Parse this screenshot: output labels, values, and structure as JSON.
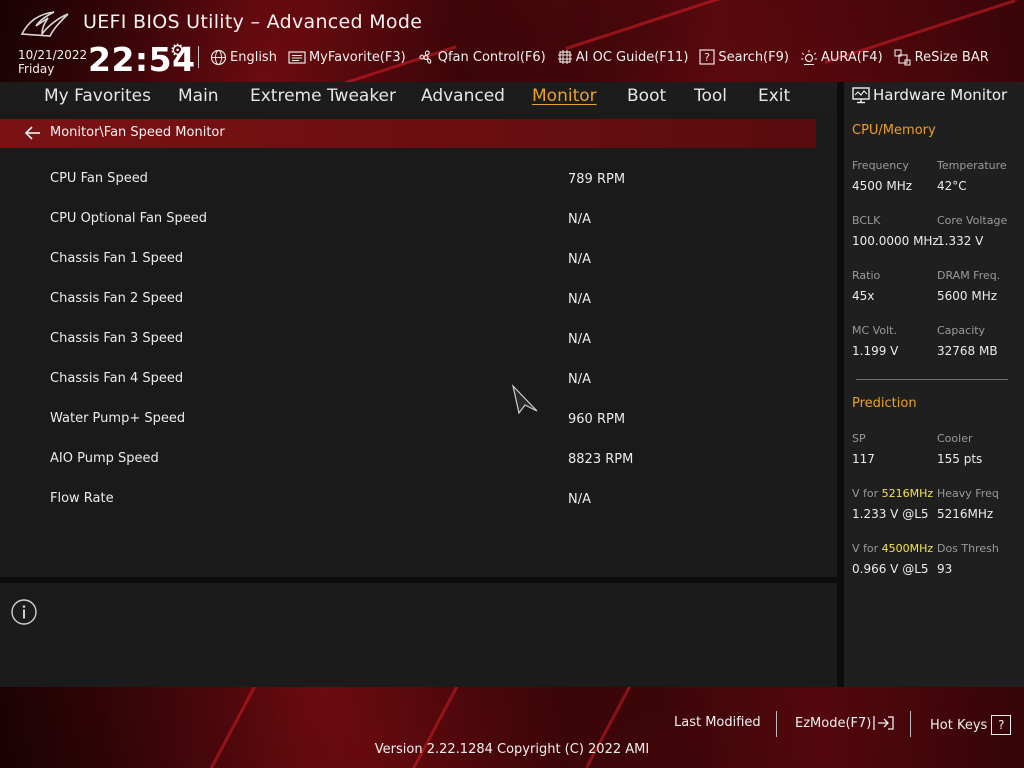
{
  "header": {
    "title": "UEFI BIOS Utility – Advanced Mode",
    "date": "10/21/2022",
    "day": "Friday",
    "time": "22:54",
    "toolbar": [
      {
        "label": "English",
        "icon": "globe-icon"
      },
      {
        "label": "MyFavorite(F3)",
        "icon": "favorite-icon"
      },
      {
        "label": "Qfan Control(F6)",
        "icon": "fan-icon"
      },
      {
        "label": "AI OC Guide(F11)",
        "icon": "ai-chip-icon"
      },
      {
        "label": "Search(F9)",
        "icon": "search-help-icon"
      },
      {
        "label": "AURA(F4)",
        "icon": "aura-light-icon"
      },
      {
        "label": "ReSize BAR",
        "icon": "resize-bar-icon"
      }
    ]
  },
  "menu": {
    "items": [
      "My Favorites",
      "Main",
      "Extreme Tweaker",
      "Advanced",
      "Monitor",
      "Boot",
      "Tool",
      "Exit"
    ],
    "active": "Monitor"
  },
  "breadcrumb": "Monitor\\Fan Speed Monitor",
  "rows": [
    {
      "label": "CPU Fan Speed",
      "value": "789 RPM"
    },
    {
      "label": "CPU Optional Fan Speed",
      "value": "N/A"
    },
    {
      "label": "Chassis Fan 1 Speed",
      "value": "N/A"
    },
    {
      "label": "Chassis Fan 2 Speed",
      "value": "N/A"
    },
    {
      "label": "Chassis Fan 3 Speed",
      "value": "N/A"
    },
    {
      "label": "Chassis Fan 4 Speed",
      "value": "N/A"
    },
    {
      "label": "Water Pump+ Speed",
      "value": "960 RPM"
    },
    {
      "label": "AIO Pump Speed",
      "value": "8823 RPM"
    },
    {
      "label": "Flow Rate",
      "value": "N/A"
    }
  ],
  "hardware_monitor": {
    "title": "Hardware Monitor",
    "cpu_memory": {
      "title": "CPU/Memory",
      "frequency_label": "Frequency",
      "frequency": "4500 MHz",
      "temperature_label": "Temperature",
      "temperature": "42°C",
      "bclk_label": "BCLK",
      "bclk": "100.0000 MHz",
      "core_voltage_label": "Core Voltage",
      "core_voltage": "1.332 V",
      "ratio_label": "Ratio",
      "ratio": "45x",
      "dram_freq_label": "DRAM Freq.",
      "dram_freq": "5600 MHz",
      "mc_volt_label": "MC Volt.",
      "mc_volt": "1.199 V",
      "capacity_label": "Capacity",
      "capacity": "32768 MB"
    },
    "prediction": {
      "title": "Prediction",
      "sp_label": "SP",
      "sp": "117",
      "cooler_label": "Cooler",
      "cooler": "155 pts",
      "v_for_label": "V for",
      "v_for_1_freq": "5216MHz",
      "v_for_1": "1.233 V @L5",
      "heavy_freq_label": "Heavy Freq",
      "heavy_freq": "5216MHz",
      "v_for_2_freq": "4500MHz",
      "v_for_2": "0.966 V @L5",
      "dos_thresh_label": "Dos Thresh",
      "dos_thresh": "93"
    }
  },
  "footer": {
    "last_modified": "Last Modified",
    "ezmode": "EzMode(F7)",
    "hot_keys": "Hot Keys",
    "hot_keys_key": "?",
    "version": "Version 2.22.1284 Copyright (C) 2022 AMI"
  },
  "colors": {
    "accent": "#e8a02e",
    "highlight": "#f3e34a",
    "brand_red": "#7a1214"
  }
}
